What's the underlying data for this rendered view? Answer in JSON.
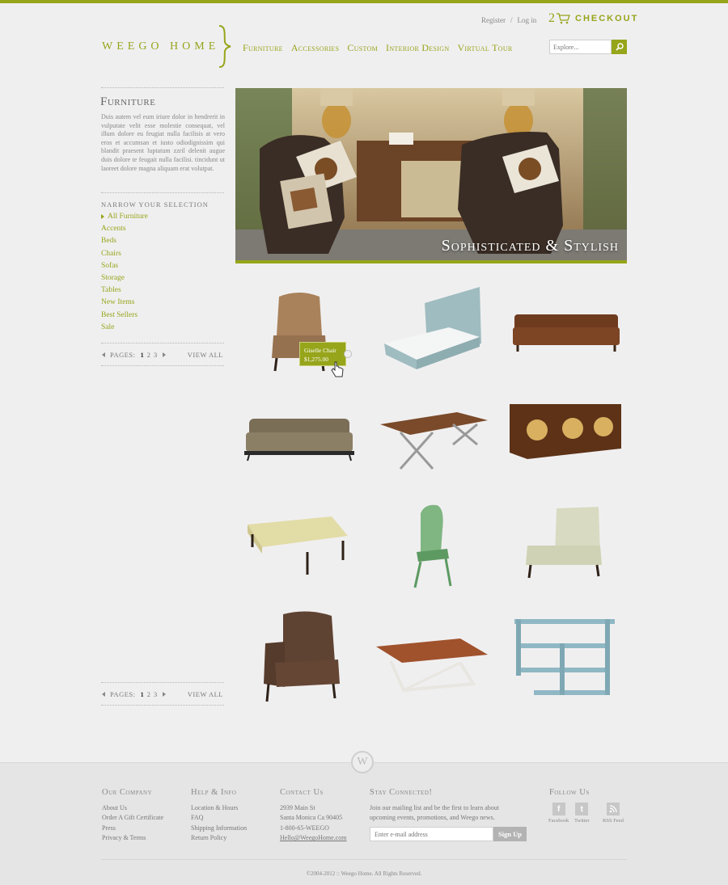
{
  "header": {
    "register_label": "Register",
    "separator": "/",
    "login_label": "Log in",
    "cart_count": "2",
    "checkout_label": "CHECKOUT",
    "logo_text": "WEEGO HOME",
    "nav": [
      "Furniture",
      "Accessories",
      "Custom",
      "Interior Design",
      "Virtual Tour"
    ],
    "search_placeholder": "Explore..."
  },
  "sidebar": {
    "title": "Furniture",
    "description": "Duis autem vel eum iriure dolor in hendrerit in vulputate velit esse molestie consequat, vel illum dolore eu feugiat nulla facilisis at vero eros et accumsan et iusto odiodignissim qui blandit praesent luptatum zzril delenit augue duis dolore te feugait nulla facilisi. tincidunt ut laoreet dolore magna aliquam erat volutpat.",
    "narrow_label": "NARROW YOUR SELECTION",
    "categories": [
      "All Furniture",
      "Accents",
      "Beds",
      "Chairs",
      "Sofas",
      "Storage",
      "Tables",
      "New Items",
      "Best Sellers",
      "Sale"
    ],
    "active_category": "All Furniture"
  },
  "pagination": {
    "label": "PAGES:",
    "pages": [
      "1",
      "2",
      "3"
    ],
    "current": "1",
    "view_all": "VIEW ALL"
  },
  "hero": {
    "caption": "Sophisticated & Stylish"
  },
  "tooltip": {
    "name": "Giselle Chair",
    "price": "$1,275.00"
  },
  "footer": {
    "company": {
      "title": "Our Company",
      "links": [
        "About Us",
        "Order A Gift Certificate",
        "Press",
        "Privacy & Terms"
      ]
    },
    "help": {
      "title": "Help & Info",
      "links": [
        "Location & Hours",
        "FAQ",
        "Shipping Information",
        "Return Policy"
      ]
    },
    "contact": {
      "title": "Contact Us",
      "address1": "2939 Main St",
      "address2": "Santa Monica Ca 90405",
      "phone": "1-800-65-WEEGO",
      "email": "Hello@WeegoHome.com"
    },
    "stay": {
      "title": "Stay Connected!",
      "text": "Join our mailing list and be the first to learn about upcoming events, promotions, and Weego news.",
      "email_placeholder": "Enter e-mail address",
      "signup_label": "Sign Up"
    },
    "follow": {
      "title": "Follow Us",
      "facebook": "Facebook",
      "twitter": "Twitter",
      "rss": "RSS Feed"
    },
    "badge": "W",
    "copyright": "©2004-2012 :: Weego Home. All Rights Reserved."
  },
  "colors": {
    "accent": "#96a51a",
    "background": "#f0eff0",
    "footer": "#e6e5e6"
  }
}
